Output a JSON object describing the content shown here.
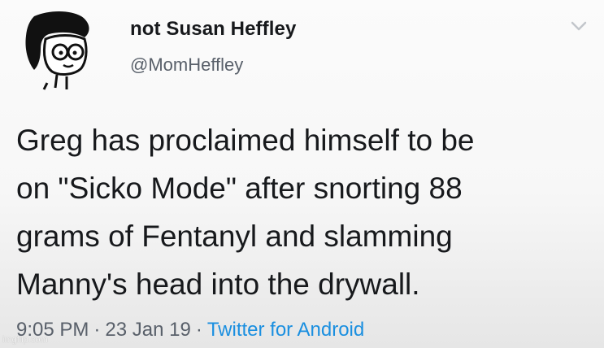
{
  "author": {
    "display_name": "not Susan Heffley",
    "handle": "@MomHeffley",
    "avatar_icon": "cartoon-woman-avatar"
  },
  "menu": {
    "icon": "chevron-down-icon"
  },
  "tweet": {
    "lines": [
      "Greg has proclaimed himself to be",
      "on \"Sicko Mode\" after snorting 88",
      "grams of Fentanyl and slamming",
      "Manny's head into the drywall."
    ]
  },
  "meta": {
    "time": "9:05 PM",
    "separator": "·",
    "date": "23 Jan 19",
    "source": "Twitter for Android"
  },
  "watermark": "imgflip.com",
  "colors": {
    "text": "#17191c",
    "muted": "#59606a",
    "link": "#1a8fe0"
  }
}
